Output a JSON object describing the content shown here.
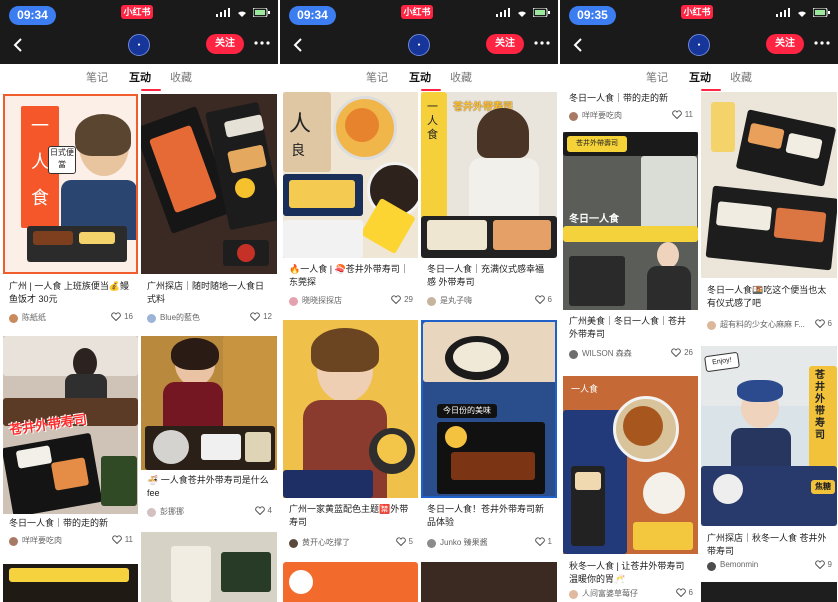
{
  "panels": [
    {
      "time": "09:34",
      "brand": "小红书",
      "follow": "关注",
      "tabs": [
        "笔记",
        "互动",
        "收藏"
      ],
      "active_tab": 1,
      "cards": [
        {
          "title": "广州 | 一人食 上班族便当💰鳗鱼饭才 30元",
          "author": "陈紙纸",
          "likes": "16"
        },
        {
          "title": "广州探店｜随时随地一人食日式料",
          "author": "Blue的藍色",
          "likes": "12"
        },
        {
          "title": "冬日一人食｜带的走的新",
          "author": "咩咩要吃肉",
          "likes": "11"
        },
        {
          "title": "🍜 一人食苍井外带寿司是什么 fee",
          "author": "彭挪挪",
          "likes": "4"
        }
      ]
    },
    {
      "time": "09:34",
      "brand": "小红书",
      "follow": "关注",
      "tabs": [
        "笔记",
        "互动",
        "收藏"
      ],
      "active_tab": 1,
      "cards": [
        {
          "title": "🔥一人食 | 🍣苍井外带寿司｜东莞探",
          "author": "晓晓探探店",
          "likes": "29"
        },
        {
          "title": "冬日一人食｜充满仪式感幸福感 外带寿司",
          "author": "是丸子嗨",
          "likes": "6"
        },
        {
          "title": "广州一家黄蓝配色主题🈲外带寿司",
          "author": "黄开心吃撑了",
          "likes": "5"
        },
        {
          "title": "冬日一人食！苍井外带寿司新品体验",
          "author": "Junko 臻果酱",
          "likes": "1"
        }
      ]
    },
    {
      "time": "09:35",
      "brand": "小红书",
      "follow": "关注",
      "tabs": [
        "笔记",
        "互动",
        "收藏"
      ],
      "active_tab": 1,
      "cards": [
        {
          "title": "冬日一人食｜带的走的新",
          "author": "咩咩要吃肉",
          "likes": "11"
        },
        {
          "title": "冬日一人食🍱吃这个便当也太有仪式感了吧",
          "author": "超有料的少女心麻麻 F...",
          "likes": "6"
        },
        {
          "title": "广州美食｜冬日一人食｜苍井外带寿司",
          "author": "WILSON 森森",
          "likes": "26"
        },
        {
          "title": "广州探店｜秋冬一人食 苍井外带寿司",
          "author": "Bemonmin",
          "likes": "9"
        },
        {
          "title": "秋冬一人食 | 让苍井外带寿司温暖你的胃🥂",
          "author": "人间富婆草莓仔",
          "likes": "6"
        }
      ]
    }
  ],
  "image_text": {
    "p1c1_a": "一",
    "p1c1_b": "人",
    "p1c1_c": "食",
    "p1c1_d": "日式便當",
    "p1c3_tag": "苍井外带寿司",
    "p2c1_big": "人",
    "p2c1_b": "良",
    "p2c2_tag": "苍井外带寿司",
    "p2c2_left": "一人食",
    "p2c4_tag": "今日份的美味",
    "p3c2_tag": "苍井外帶壽司",
    "p3c2_b": "冬日一人食",
    "p3c3_a": "一人食",
    "p3c4_tag": "Enjoy!",
    "p3c4_b": "苍井外带寿司",
    "p3c4_c": "焦糖"
  },
  "colors": {
    "accent": "#ff2442",
    "dark": "#1a1a1a",
    "blue": "#3c7ef1"
  }
}
